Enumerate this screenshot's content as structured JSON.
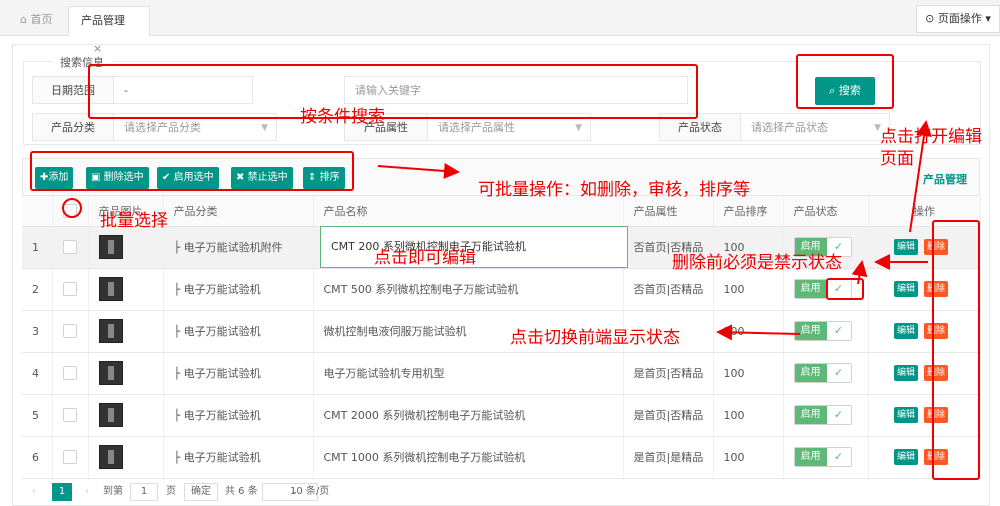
{
  "tabs": {
    "home": "首页",
    "active": "产品管理",
    "close": "×"
  },
  "page_ops": "页面操作",
  "search": {
    "legend": "搜索信息",
    "date_label": "日期范围",
    "date_value": "-",
    "keyword_placeholder": "请输入关键字",
    "button": "搜索",
    "category_label": "产品分类",
    "category_placeholder": "请选择产品分类",
    "attr_label": "产品属性",
    "attr_placeholder": "请选择产品属性",
    "status_label": "产品状态",
    "status_placeholder": "请选择产品状态"
  },
  "toolbar": {
    "add": "添加",
    "delete_selected": "删除选中",
    "enable_selected": "启用选中",
    "disable_selected": "禁止选中",
    "sort": "排序",
    "title": "产品管理"
  },
  "table": {
    "headers": [
      "",
      "产品图片",
      "产品分类",
      "产品名称",
      "产品属性",
      "产品排序",
      "产品状态",
      "操作"
    ],
    "rows": [
      {
        "no": "1",
        "category": "├ 电子万能试验机附件",
        "name": "CMT 200 系列微机控制电子万能试验机",
        "attr": "否首页|否精品",
        "sort": "100"
      },
      {
        "no": "2",
        "category": "├ 电子万能试验机",
        "name": "CMT 500 系列微机控制电子万能试验机",
        "attr": "否首页|否精品",
        "sort": "100"
      },
      {
        "no": "3",
        "category": "├ 电子万能试验机",
        "name": "微机控制电液伺服万能试验机",
        "attr": "",
        "sort": "100"
      },
      {
        "no": "4",
        "category": "├ 电子万能试验机",
        "name": "电子万能试验机专用机型",
        "attr": "是首页|否精品",
        "sort": "100"
      },
      {
        "no": "5",
        "category": "├ 电子万能试验机",
        "name": "CMT 2000 系列微机控制电子万能试验机",
        "attr": "是首页|否精品",
        "sort": "100"
      },
      {
        "no": "6",
        "category": "├ 电子万能试验机",
        "name": "CMT 1000 系列微机控制电子万能试验机",
        "attr": "是首页|是精品",
        "sort": "100"
      }
    ],
    "status_on": "启用",
    "edit": "编辑",
    "delete": "删除"
  },
  "pager": {
    "current": "1",
    "goto": "到第",
    "page_input": "1",
    "page_unit": "页",
    "confirm": "确定",
    "total": "共 6 条",
    "per_page": "10 条/页"
  },
  "annotations": {
    "search": "按条件搜索",
    "batch_ops": "可批量操作：如删除，审核，排序等",
    "batch_select": "批量选择",
    "inline_edit": "点击即可编辑",
    "open_edit": "点击打开编辑页面",
    "delete_rule": "删除前必须是禁示状态",
    "toggle": "点击切换前端显示状态"
  },
  "colors": {
    "primary": "#009688",
    "danger": "#ff5722",
    "toggle": "#5fb878",
    "annotation": "#e00000"
  }
}
